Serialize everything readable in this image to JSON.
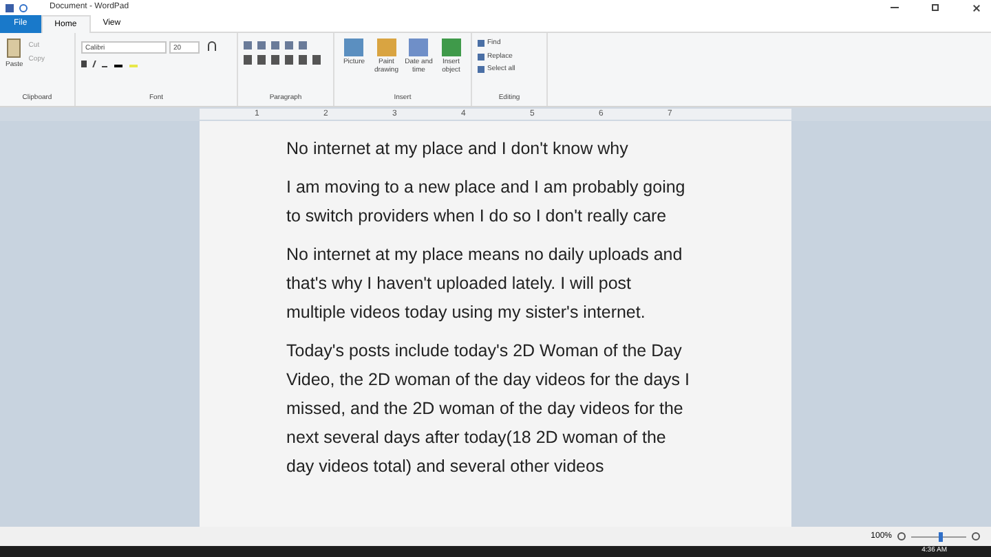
{
  "window": {
    "title": "Document - WordPad"
  },
  "tabs": [
    {
      "label": "File",
      "selected": false,
      "kind": "file"
    },
    {
      "label": "Home",
      "selected": true,
      "kind": "tab"
    },
    {
      "label": "View",
      "selected": false,
      "kind": "tab"
    }
  ],
  "ribbon": {
    "clipboard": {
      "paste": "Paste",
      "cut": "Cut",
      "copy": "Copy",
      "label": "Clipboard"
    },
    "font": {
      "family": "Calibri",
      "size": "20",
      "label": "Font"
    },
    "paragraph": {
      "label": "Paragraph"
    },
    "insert": {
      "items": [
        "Picture",
        "Paint drawing",
        "Date and time",
        "Insert object"
      ],
      "label": "Insert"
    },
    "editing": {
      "items": [
        "Find",
        "Replace",
        "Select all"
      ],
      "label": "Editing"
    }
  },
  "ruler": {
    "marks": [
      "1",
      "2",
      "3",
      "4",
      "5",
      "6",
      "7"
    ]
  },
  "document": {
    "paragraphs": [
      {
        "lines": [
          "No internet at my place and I don't know why"
        ]
      },
      {
        "lines": [
          "I am moving to a new place and I am probably going",
          "to switch providers when I do so I don't really care"
        ]
      },
      {
        "lines": [
          "No internet at my place means no daily uploads and",
          "that's why I haven't uploaded lately. I will post",
          "multiple videos today using my sister's internet."
        ]
      },
      {
        "lines": [
          "Today's posts include today's 2D Woman of the Day",
          "Video, the 2D woman of the day videos for the days I",
          "missed, and the 2D woman of the day videos for the",
          "next several days after today(18 2D woman of the",
          "day videos total) and several other videos"
        ]
      }
    ]
  },
  "status_bar": {
    "zoom": "100%",
    "level": 0.55
  },
  "taskbar": {
    "time": "4:36 AM"
  }
}
